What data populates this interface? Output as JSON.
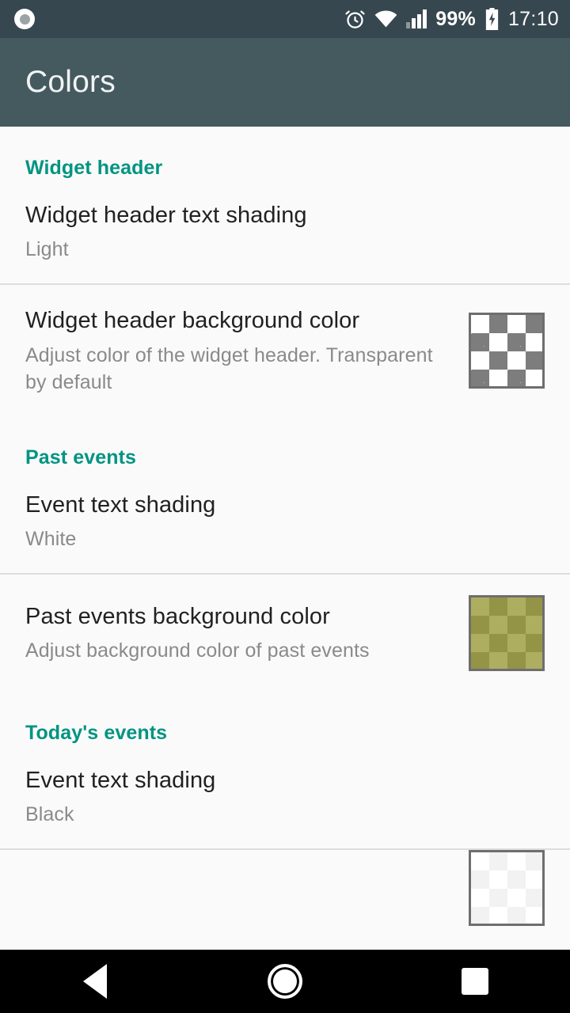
{
  "statusbar": {
    "notification_icon": "circle-notification-icon",
    "alarm_icon": "alarm-clock-icon",
    "wifi_icon": "wifi-icon",
    "signal_icon": "cellular-signal-icon",
    "battery_text": "99%",
    "battery_icon": "battery-charging-icon",
    "time": "17:10",
    "background_color": "#37474f"
  },
  "appbar": {
    "title": "Colors",
    "background_color": "#455a5f",
    "title_color": "#f0f3f4"
  },
  "theme": {
    "section_header_color": "#009481",
    "page_background": "#fafafa",
    "divider_color": "#dddddd",
    "title_color": "#212121",
    "subtitle_color": "#8a8a8a"
  },
  "sections": [
    {
      "header": "Widget header",
      "rows": [
        {
          "title": "Widget header text shading",
          "subtitle": "Light",
          "has_swatch": false
        },
        {
          "title": "Widget header background color",
          "subtitle": "Adjust color of the widget header. Transparent by default",
          "has_swatch": true,
          "swatch_name": "widget-header-background-color-swatch",
          "swatch_tint": "transparent"
        }
      ]
    },
    {
      "header": "Past events",
      "rows": [
        {
          "title": "Event text shading",
          "subtitle": "White",
          "has_swatch": false
        },
        {
          "title": "Past events background color",
          "subtitle": "Adjust background color of past events",
          "has_swatch": true,
          "swatch_name": "past-events-background-color-swatch",
          "swatch_tint": "rgba(154,154,56,0.80)"
        }
      ]
    },
    {
      "header": "Today's events",
      "rows": [
        {
          "title": "Event text shading",
          "subtitle": "Black",
          "has_swatch": false
        },
        {
          "title": "",
          "subtitle": "",
          "has_swatch": true,
          "clipped": true,
          "swatch_name": "todays-events-background-color-swatch",
          "swatch_tint": "rgba(255,255,255,0.90)"
        }
      ]
    }
  ],
  "navbar": {
    "back_label": "Back",
    "home_label": "Home",
    "recents_label": "Recent apps",
    "background_color": "#000000"
  }
}
